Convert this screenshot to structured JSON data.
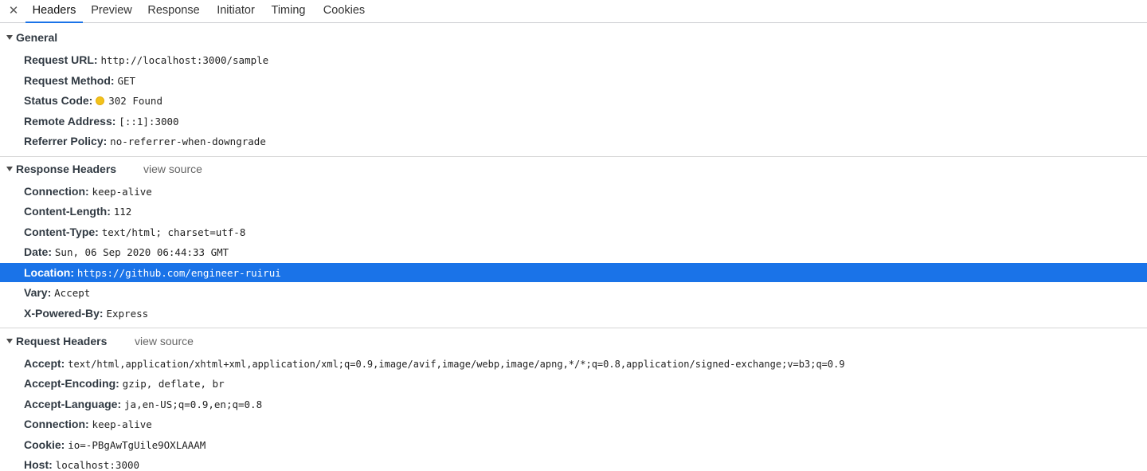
{
  "tabs": {
    "close_icon": "close-icon",
    "items": [
      "Headers",
      "Preview",
      "Response",
      "Initiator",
      "Timing",
      "Cookies"
    ],
    "active": "Headers"
  },
  "general": {
    "title": "General",
    "rows": [
      {
        "key": "Request URL:",
        "value": "http://localhost:3000/sample"
      },
      {
        "key": "Request Method:",
        "value": "GET"
      },
      {
        "key": "Status Code:",
        "value": "302 Found",
        "status_dot_color": "#f2c21a"
      },
      {
        "key": "Remote Address:",
        "value": "[::1]:3000"
      },
      {
        "key": "Referrer Policy:",
        "value": "no-referrer-when-downgrade"
      }
    ]
  },
  "response_headers": {
    "title": "Response Headers",
    "view_source": "view source",
    "rows": [
      {
        "key": "Connection:",
        "value": "keep-alive"
      },
      {
        "key": "Content-Length:",
        "value": "112"
      },
      {
        "key": "Content-Type:",
        "value": "text/html; charset=utf-8"
      },
      {
        "key": "Date:",
        "value": "Sun, 06 Sep 2020 06:44:33 GMT"
      },
      {
        "key": "Location:",
        "value": "https://github.com/engineer-ruirui",
        "selected": true
      },
      {
        "key": "Vary:",
        "value": "Accept"
      },
      {
        "key": "X-Powered-By:",
        "value": "Express"
      }
    ]
  },
  "request_headers": {
    "title": "Request Headers",
    "view_source": "view source",
    "rows": [
      {
        "key": "Accept:",
        "value": "text/html,application/xhtml+xml,application/xml;q=0.9,image/avif,image/webp,image/apng,*/*;q=0.8,application/signed-exchange;v=b3;q=0.9"
      },
      {
        "key": "Accept-Encoding:",
        "value": "gzip, deflate, br"
      },
      {
        "key": "Accept-Language:",
        "value": "ja,en-US;q=0.9,en;q=0.8"
      },
      {
        "key": "Connection:",
        "value": "keep-alive"
      },
      {
        "key": "Cookie:",
        "value": "io=-PBgAwTgUile9OXLAAAM"
      },
      {
        "key": "Host:",
        "value": "localhost:3000"
      }
    ]
  },
  "colors": {
    "accent": "#1a73e8",
    "selected_row_bg": "#1a73e8"
  }
}
